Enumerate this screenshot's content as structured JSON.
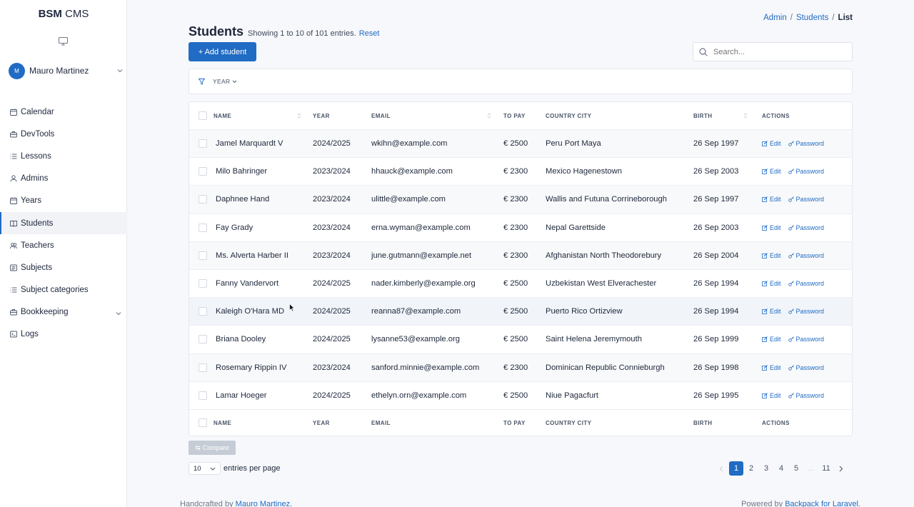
{
  "brand": {
    "bold": "BSM",
    "rest": "CMS"
  },
  "user": {
    "initials": "M",
    "name": "Mauro Martinez"
  },
  "nav": [
    {
      "label": "Calendar",
      "icon": "calendar-icon"
    },
    {
      "label": "DevTools",
      "icon": "briefcase-icon"
    },
    {
      "label": "Lessons",
      "icon": "list-icon"
    },
    {
      "label": "Admins",
      "icon": "user-icon"
    },
    {
      "label": "Years",
      "icon": "calendar-icon"
    },
    {
      "label": "Students",
      "icon": "book-icon",
      "active": true
    },
    {
      "label": "Teachers",
      "icon": "users-icon"
    },
    {
      "label": "Subjects",
      "icon": "news-icon"
    },
    {
      "label": "Subject categories",
      "icon": "list-icon"
    },
    {
      "label": "Bookkeeping",
      "icon": "briefcase-icon",
      "has_children": true
    },
    {
      "label": "Logs",
      "icon": "terminal-icon"
    }
  ],
  "breadcrumb": {
    "admin": "Admin",
    "students": "Students",
    "current": "List",
    "sep": "/"
  },
  "page": {
    "title": "Students",
    "showing": "Showing 1 to 10 of 101 entries.",
    "reset": "Reset"
  },
  "toolbar": {
    "add_label": "+ Add student",
    "search_placeholder": "Search..."
  },
  "filter": {
    "year_label": "YEAR"
  },
  "table": {
    "columns": {
      "name": "NAME",
      "year": "YEAR",
      "email": "EMAIL",
      "to_pay": "TO PAY",
      "country_city": "COUNTRY CITY",
      "birth": "BIRTH",
      "actions": "ACTIONS"
    },
    "action_labels": {
      "edit": "Edit",
      "password": "Password"
    },
    "rows": [
      {
        "name": "Jamel Marquardt V",
        "year": "2024/2025",
        "email": "wkihn@example.com",
        "to_pay": "€ 2500",
        "country_city": "Peru Port Maya",
        "birth": "26 Sep 1997"
      },
      {
        "name": "Milo Bahringer",
        "year": "2023/2024",
        "email": "hhauck@example.com",
        "to_pay": "€ 2300",
        "country_city": "Mexico Hagenestown",
        "birth": "26 Sep 2003"
      },
      {
        "name": "Daphnee Hand",
        "year": "2023/2024",
        "email": "ulittle@example.com",
        "to_pay": "€ 2300",
        "country_city": "Wallis and Futuna Corrineborough",
        "birth": "26 Sep 1997"
      },
      {
        "name": "Fay Grady",
        "year": "2023/2024",
        "email": "erna.wyman@example.com",
        "to_pay": "€ 2300",
        "country_city": "Nepal Garettside",
        "birth": "26 Sep 2003"
      },
      {
        "name": "Ms. Alverta Harber II",
        "year": "2023/2024",
        "email": "june.gutmann@example.net",
        "to_pay": "€ 2300",
        "country_city": "Afghanistan North Theodorebury",
        "birth": "26 Sep 2004"
      },
      {
        "name": "Fanny Vandervort",
        "year": "2024/2025",
        "email": "nader.kimberly@example.org",
        "to_pay": "€ 2500",
        "country_city": "Uzbekistan West Elverachester",
        "birth": "26 Sep 1994"
      },
      {
        "name": "Kaleigh O'Hara MD",
        "year": "2024/2025",
        "email": "reanna87@example.com",
        "to_pay": "€ 2500",
        "country_city": "Puerto Rico Ortizview",
        "birth": "26 Sep 1994"
      },
      {
        "name": "Briana Dooley",
        "year": "2024/2025",
        "email": "lysanne53@example.org",
        "to_pay": "€ 2500",
        "country_city": "Saint Helena Jeremymouth",
        "birth": "26 Sep 1999"
      },
      {
        "name": "Rosemary Rippin IV",
        "year": "2023/2024",
        "email": "sanford.minnie@example.com",
        "to_pay": "€ 2300",
        "country_city": "Dominican Republic Connieburgh",
        "birth": "26 Sep 1998"
      },
      {
        "name": "Lamar Hoeger",
        "year": "2024/2025",
        "email": "ethelyn.orn@example.com",
        "to_pay": "€ 2500",
        "country_city": "Niue Pagacfurt",
        "birth": "26 Sep 1995"
      }
    ]
  },
  "compare_label": "Compare",
  "per_page": {
    "value": "10",
    "label": "entries per page"
  },
  "pagination": {
    "pages": [
      "1",
      "2",
      "3",
      "4",
      "5",
      "...",
      "11"
    ],
    "active": "1"
  },
  "footer": {
    "left_prefix": "Handcrafted by",
    "left_link": "Mauro Martinez.",
    "right_prefix": "Powered by",
    "right_link": "Backpack for Laravel."
  },
  "colors": {
    "accent": "#206bc4",
    "sidebar_bg": "#ffffff",
    "page_bg": "#f7f8fb"
  }
}
